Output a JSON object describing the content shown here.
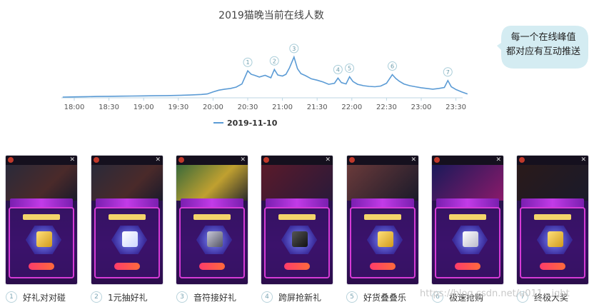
{
  "chart_data": {
    "type": "line",
    "title": "2019猫晚当前在线人数",
    "x_ticks": [
      "18:00",
      "18:30",
      "19:00",
      "19:30",
      "20:00",
      "20:30",
      "21:00",
      "21:30",
      "22:00",
      "22:30",
      "23:00",
      "23:30"
    ],
    "series": [
      {
        "name": "2019-11-10",
        "color": "#5b9bd5",
        "x": [
          "17:50",
          "18:00",
          "18:10",
          "18:20",
          "18:30",
          "18:40",
          "18:50",
          "19:00",
          "19:10",
          "19:20",
          "19:30",
          "19:40",
          "19:50",
          "19:55",
          "20:00",
          "20:05",
          "20:10",
          "20:15",
          "20:20",
          "20:25",
          "20:30",
          "20:33",
          "20:36",
          "20:40",
          "20:45",
          "20:50",
          "20:53",
          "20:56",
          "21:00",
          "21:03",
          "21:06",
          "21:10",
          "21:13",
          "21:16",
          "21:20",
          "21:25",
          "21:30",
          "21:35",
          "21:40",
          "21:45",
          "21:48",
          "21:51",
          "21:55",
          "21:58",
          "22:01",
          "22:05",
          "22:10",
          "22:15",
          "22:20",
          "22:25",
          "22:30",
          "22:35",
          "22:38",
          "22:41",
          "22:45",
          "22:50",
          "22:55",
          "23:00",
          "23:05",
          "23:10",
          "23:15",
          "23:20",
          "23:23",
          "23:26",
          "23:30",
          "23:35",
          "23:40"
        ],
        "y": [
          0.0,
          0.3,
          0.6,
          0.9,
          1.1,
          1.3,
          1.5,
          1.8,
          2.0,
          2.2,
          2.5,
          3.0,
          3.8,
          4.5,
          7.5,
          10.0,
          11.5,
          12.5,
          14.5,
          19.0,
          38.0,
          33.0,
          31.5,
          29.0,
          31.5,
          28.0,
          40.0,
          32.0,
          30.5,
          33.0,
          42.0,
          58.0,
          41.0,
          34.0,
          31.0,
          26.5,
          24.5,
          22.0,
          18.5,
          20.0,
          27.5,
          21.0,
          19.0,
          29.5,
          22.5,
          18.5,
          16.5,
          15.5,
          15.0,
          16.0,
          20.0,
          32.5,
          27.0,
          23.0,
          19.0,
          16.5,
          15.0,
          13.5,
          12.5,
          11.5,
          12.5,
          14.0,
          24.0,
          15.0,
          11.0,
          7.5,
          4.5
        ]
      }
    ],
    "ylim": [
      0,
      62
    ],
    "grid": false,
    "legend": "bottom-center",
    "peak_markers": [
      {
        "label": "1",
        "x": "20:30"
      },
      {
        "label": "2",
        "x": "20:53"
      },
      {
        "label": "3",
        "x": "21:10"
      },
      {
        "label": "4",
        "x": "21:48"
      },
      {
        "label": "5",
        "x": "21:58"
      },
      {
        "label": "6",
        "x": "22:35"
      },
      {
        "label": "7",
        "x": "23:23"
      }
    ]
  },
  "callout": {
    "line1": "每一个在线峰值",
    "line2": "都对应有互动推送"
  },
  "captions": [
    {
      "num": "1",
      "text": "好礼对对碰"
    },
    {
      "num": "2",
      "text": "1元抽好礼"
    },
    {
      "num": "3",
      "text": "音符接好礼"
    },
    {
      "num": "4",
      "text": "跨屏抢新礼"
    },
    {
      "num": "5",
      "text": "好货叠叠乐"
    },
    {
      "num": "6",
      "text": "极速抢购"
    },
    {
      "num": "7",
      "text": "终极大奖"
    }
  ],
  "watermark": "https://blog.csdn.net/u011...ight",
  "colors": {
    "line": "#5b9bd5",
    "marker_stroke": "#a9cdd9",
    "bubble": "#d4ecf2",
    "axis": "#bcd6e3"
  }
}
